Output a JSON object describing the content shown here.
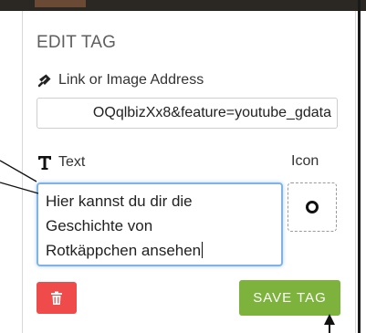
{
  "panel": {
    "title": "EDIT TAG",
    "link_label": "Link or Image Address",
    "link_value": "OQqlbizXx8&feature=youtube_gdata",
    "text_label": "Text",
    "icon_label": "Icon",
    "text_lines": [
      "Hier kannst du dir die",
      "Geschichte von",
      "Rotkäppchen ansehen"
    ],
    "save_label": "SAVE TAG"
  },
  "icons": {
    "link": "link-icon",
    "text": "text-format-icon",
    "tag_icon": "circle-icon",
    "delete": "trash-icon"
  },
  "colors": {
    "delete_button": "#f04b4b",
    "save_button": "#7db33d",
    "focus_border": "#7fb2e6"
  }
}
